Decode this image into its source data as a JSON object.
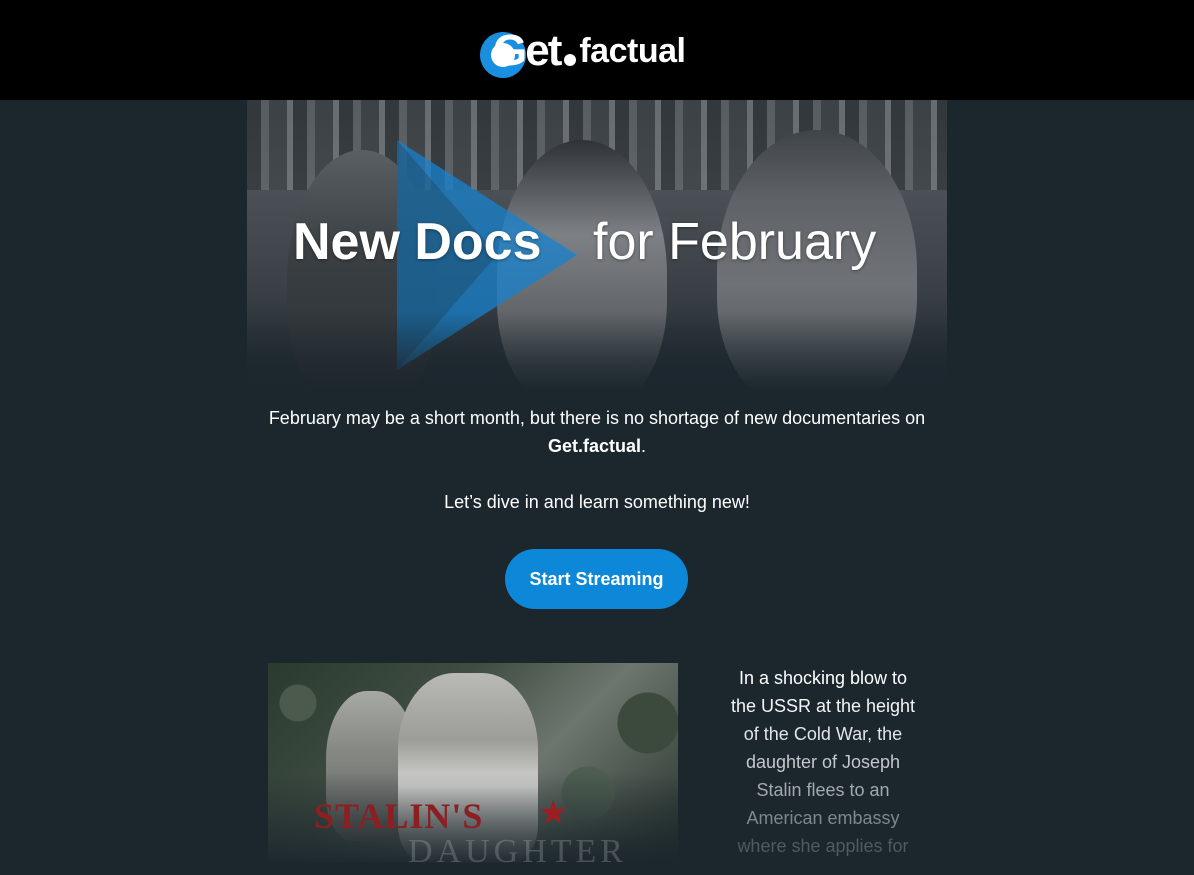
{
  "header": {
    "logo_text_get": "Get",
    "logo_text_factual": "factual",
    "logo_icon": "getfactual-logo-icon",
    "brand_color": "#1a8fe0"
  },
  "hero": {
    "title": "New Docs",
    "subtitle": "for February"
  },
  "intro": {
    "line1_prefix": "February may be a short month, but there is no shortage of new documentaries on ",
    "brand": "Get.factual",
    "line1_suffix": ".",
    "line2": "Let’s dive in and learn something new!"
  },
  "cta": {
    "label": "Start Streaming",
    "color": "#0d88d8"
  },
  "feature": {
    "poster_title": "STALIN'S",
    "poster_subtitle": "DAUGHTER",
    "poster_icon": "hammer-sickle-star-icon",
    "description_lines": [
      "In a shocking blow to",
      "the USSR at the height",
      "of the Cold War, the",
      "daughter of Joseph",
      "Stalin flees to an",
      "American embassy",
      "where she applies for"
    ]
  }
}
